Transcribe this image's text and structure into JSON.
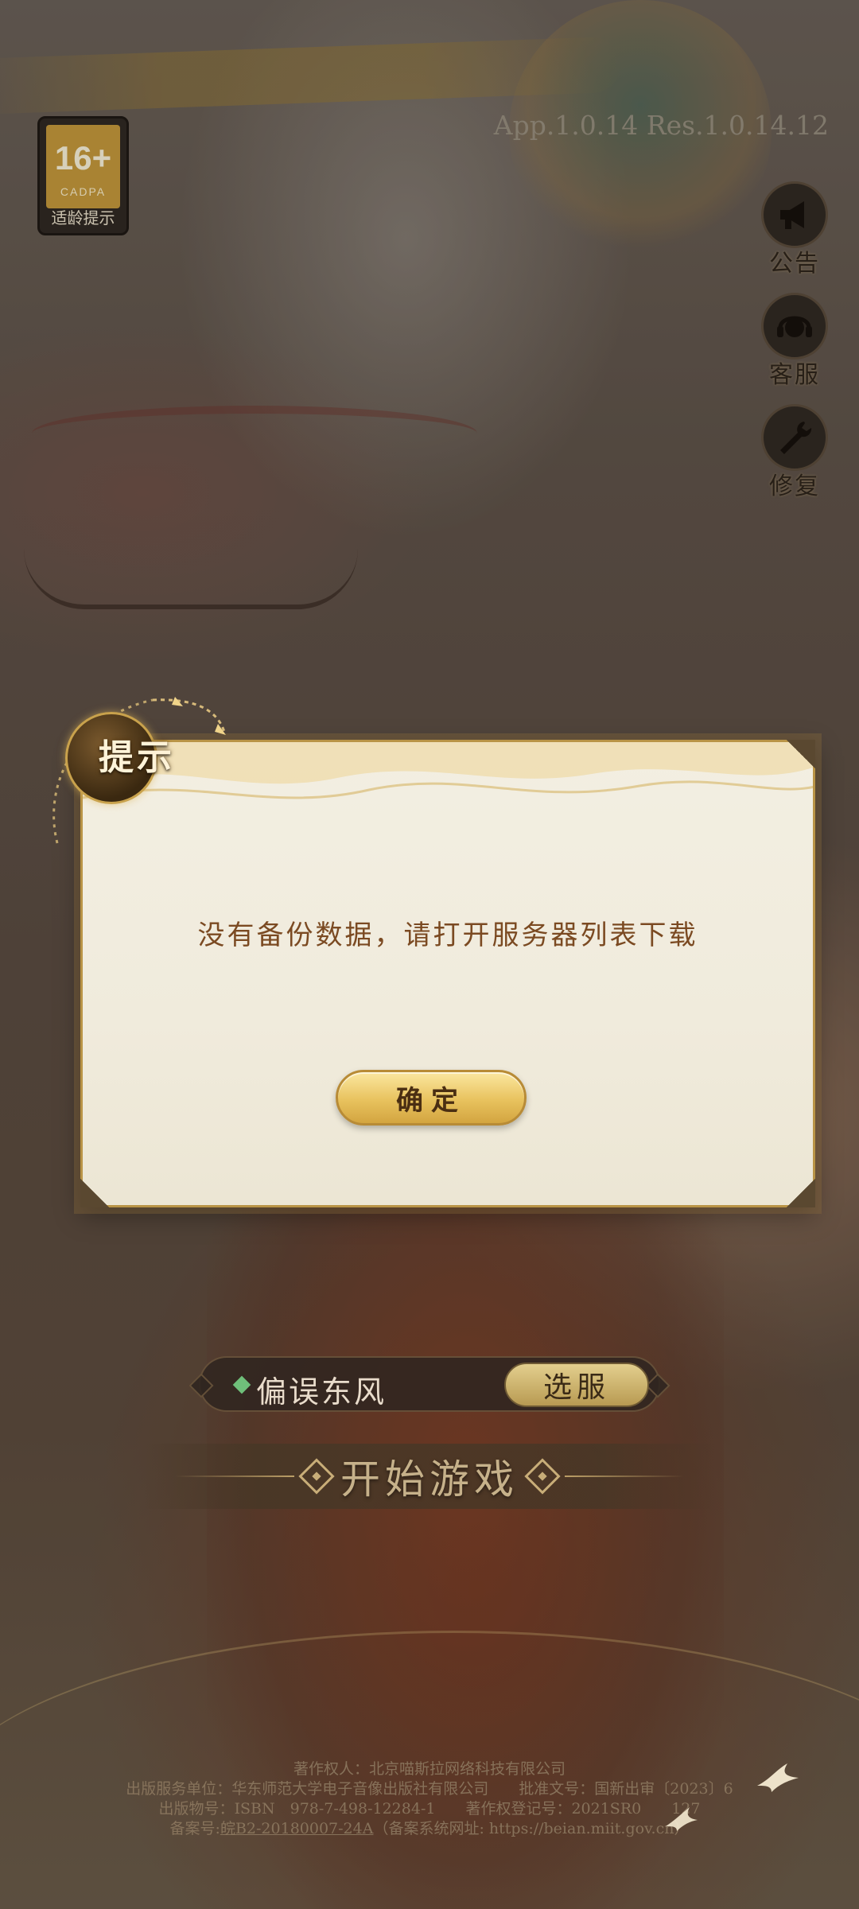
{
  "app": {
    "age_rating": {
      "number": "16+",
      "org": "CADPA",
      "label": "适龄提示"
    },
    "version": "App.1.0.14 Res.1.0.14.12"
  },
  "side_menu": [
    {
      "label": "公告",
      "icon": "megaphone-icon"
    },
    {
      "label": "客服",
      "icon": "headset-icon"
    },
    {
      "label": "修复",
      "icon": "wrench-icon"
    }
  ],
  "dialog": {
    "title": "提示",
    "message": "没有备份数据，请打开服务器列表下载",
    "ok_label": "确定"
  },
  "server": {
    "name": "偏误东风",
    "select_label": "选服"
  },
  "start": {
    "label": "开始游戏"
  },
  "footer": {
    "line1": "著作权人：北京喵斯拉网络科技有限公司",
    "line2": "出版服务单位：华东师范大学电子音像出版社有限公司　　批准文号：国新出审〔2023〕6",
    "line3": "出版物号：ISBN　978-7-498-12284-1　　著作权登记号：2021SR0　　127",
    "line4_prefix": "备案号:",
    "line4_icp": "皖B2-20180007-24A",
    "line4_suffix": "（备案系统网址: https://beian.miit.gov.cn）"
  },
  "colors": {
    "dialog_bg": "#f0ebdc",
    "dialog_border": "#b99446",
    "message_text": "#7b4a22",
    "button_gold": "#e8c25e",
    "server_dot": "#6fbf7a"
  }
}
